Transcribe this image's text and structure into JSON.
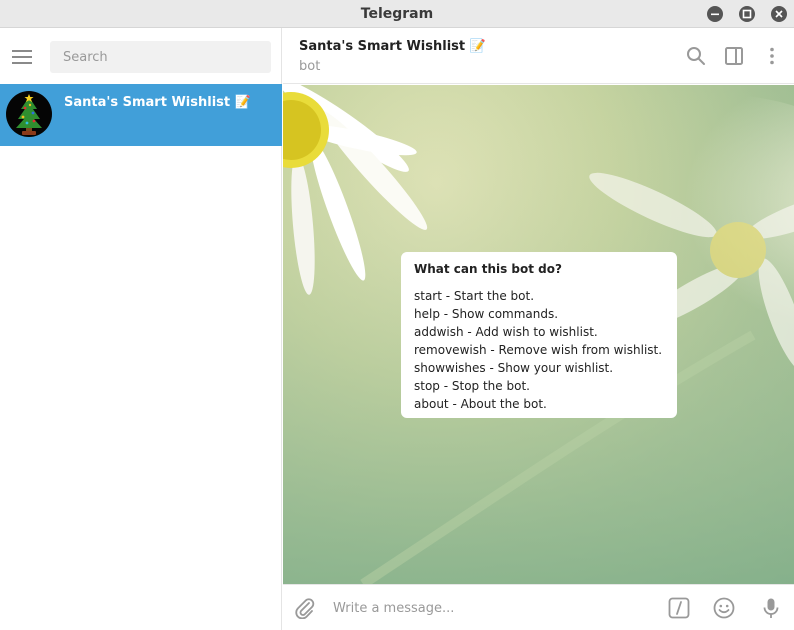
{
  "window": {
    "title": "Telegram"
  },
  "sidebar": {
    "search_placeholder": "Search",
    "chats": [
      {
        "name": "Santa's Smart Wishlist 📝",
        "avatar": "christmas-tree"
      }
    ]
  },
  "header": {
    "title": "Santa's Smart Wishlist 📝",
    "subtitle": "bot"
  },
  "bot_info": {
    "heading": "What can this bot do?",
    "lines": [
      "start - Start the bot.",
      "help - Show commands.",
      "addwish - Add wish to wishlist.",
      "removewish - Remove wish from wishlist.",
      "showwishes - Show your wishlist.",
      "stop - Stop the bot.",
      "about - About the bot."
    ]
  },
  "composer": {
    "placeholder": "Write a message..."
  },
  "icons": {
    "menu": "hamburger-icon",
    "search": "search-icon",
    "sidebar_toggle": "sidebar-toggle-icon",
    "more": "more-vertical-icon",
    "attach": "paperclip-icon",
    "commands": "slash-command-icon",
    "emoji": "emoji-icon",
    "mic": "microphone-icon"
  },
  "colors": {
    "accent": "#419fd9",
    "titlebar": "#e9e9e9",
    "icon_gray": "#999999"
  }
}
